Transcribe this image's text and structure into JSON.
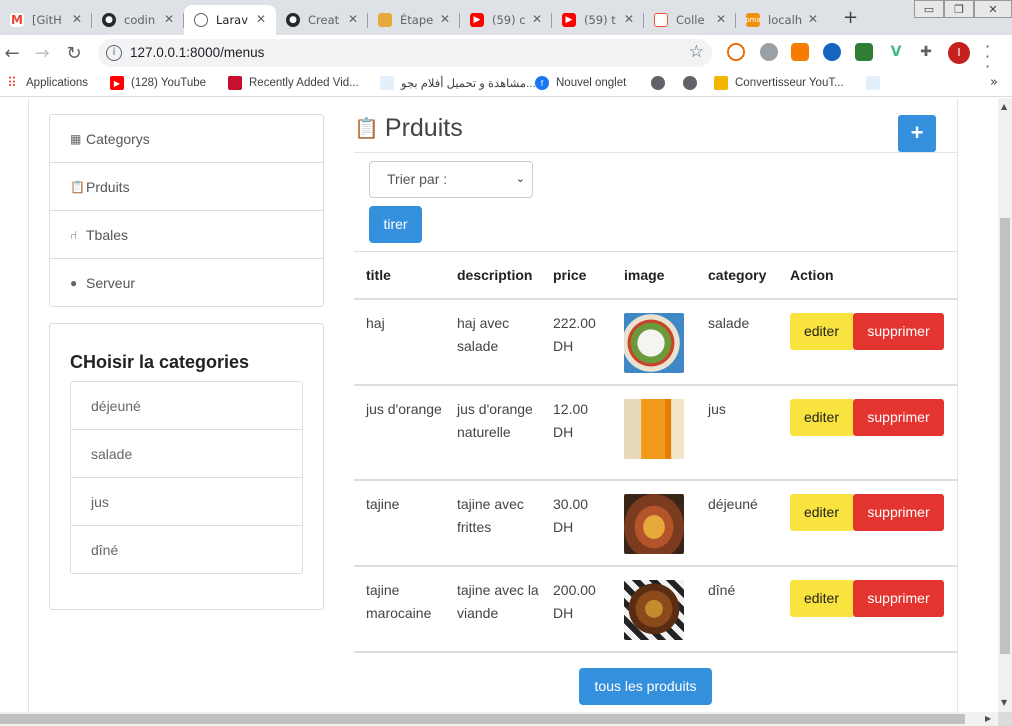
{
  "browser": {
    "tabs": [
      {
        "label": "[GitH",
        "icon": "gmail-icon",
        "color": "#ea4335"
      },
      {
        "label": "codin",
        "icon": "github-icon",
        "color": "#24292e"
      },
      {
        "label": "Larav",
        "icon": "globe-icon",
        "color": "#5f6368",
        "active": true
      },
      {
        "label": "Creat",
        "icon": "github-icon",
        "color": "#24292e"
      },
      {
        "label": "Étape",
        "icon": "box-icon",
        "color": "#e8a93b"
      },
      {
        "label": "(59) c",
        "icon": "youtube-icon",
        "color": "#ff0000"
      },
      {
        "label": "(59) t",
        "icon": "youtube-icon",
        "color": "#ff0000"
      },
      {
        "label": "Colle",
        "icon": "laravel-icon",
        "color": "#f05340"
      },
      {
        "label": "localh",
        "icon": "phpmyadmin-icon",
        "color": "#f29111"
      }
    ],
    "url": "127.0.0.1:8000/menus",
    "profile_initial": "I",
    "bookmarks": [
      {
        "label": "Applications",
        "icon": "apps-grid-icon",
        "color": "#ea4335"
      },
      {
        "label": "(128) YouTube",
        "icon": "youtube-icon",
        "color": "#ff0000"
      },
      {
        "label": "Recently Added Vid...",
        "icon": "bookmark-site-icon",
        "color": "#c8102e"
      },
      {
        "label": "مشاهدة و تحميل أفلام بجو...",
        "icon": "bookmark-site-icon",
        "color": "#3b82c4"
      },
      {
        "label": "Nouvel onglet",
        "icon": "facebook-icon",
        "color": "#1877f2"
      },
      {
        "label": "",
        "icon": "globe-icon",
        "color": "#5f6368"
      },
      {
        "label": "",
        "icon": "globe-icon",
        "color": "#5f6368"
      },
      {
        "label": "Convertisseur YouT...",
        "icon": "converter-icon",
        "color": "#f4b400"
      },
      {
        "label": "",
        "icon": "bookmark-site-icon",
        "color": "#3b82c4"
      }
    ]
  },
  "sidebar": {
    "nav": [
      {
        "label": "Categorys",
        "icon": "table-icon"
      },
      {
        "label": "Prduits",
        "icon": "clipboard-icon"
      },
      {
        "label": "Tbales",
        "icon": "chair-icon"
      },
      {
        "label": "Serveur",
        "icon": "user-icon"
      }
    ],
    "categories_title": "CHoisir la categories",
    "categories": [
      "déjeuné",
      "salade",
      "jus",
      "dîné"
    ]
  },
  "main": {
    "title": "Prduits",
    "add_label": "+",
    "sort_placeholder": "Trier par :",
    "sort_button": "tirer",
    "columns": [
      "title",
      "description",
      "price",
      "image",
      "category",
      "Action"
    ],
    "rows": [
      {
        "title": "haj",
        "description": "haj avec salade",
        "price": "222.00 DH",
        "image": "salad-image",
        "category": "salade",
        "edit": "editer",
        "delete": "supprimer"
      },
      {
        "title": "jus d'orange",
        "description": "jus d'orange naturelle",
        "price": "12.00 DH",
        "image": "orange-juice-image",
        "category": "jus",
        "edit": "editer",
        "delete": "supprimer"
      },
      {
        "title": "tajine",
        "description": "tajine avec frittes",
        "price": "30.00 DH",
        "image": "tajine-image",
        "category": "déjeuné",
        "edit": "editer",
        "delete": "supprimer"
      },
      {
        "title": "tajine marocaine",
        "description": "tajine avec la viande",
        "price": "200.00 DH",
        "image": "tajine-meat-image",
        "category": "dîné",
        "edit": "editer",
        "delete": "supprimer"
      }
    ],
    "all_products_button": "tous les produits"
  },
  "colors": {
    "primary": "#3490dc",
    "warning": "#f9e33e",
    "danger": "#e3342f"
  }
}
